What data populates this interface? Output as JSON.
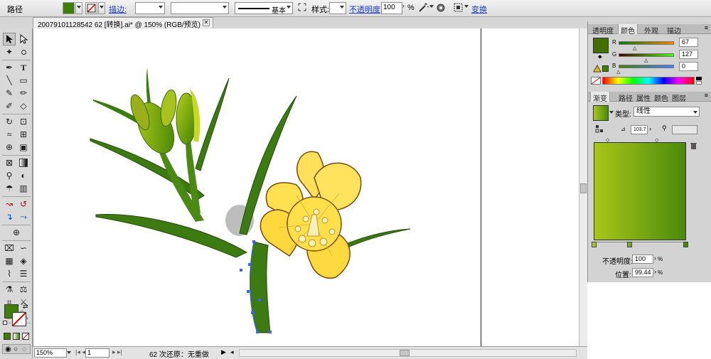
{
  "control_bar": {
    "object_type": "路径",
    "stroke_label": "描边:",
    "stroke_profile": "基本",
    "style_label": "样式:",
    "opacity_label": "不透明度",
    "opacity_value": "100",
    "opacity_unit": "%",
    "transform_label": "变换"
  },
  "document_tab": {
    "title": "20079101128542 62 [转换].ai* @ 150% (RGB/预览)"
  },
  "status_bar": {
    "zoom": "150%",
    "artboard": "1",
    "message": "62 次还原：无重做"
  },
  "color_panel": {
    "tabs": [
      "透明度",
      "颜色",
      "外观",
      "描边"
    ],
    "active_tab": "颜色",
    "fill_color": "#436f00",
    "channels": [
      {
        "name": "R",
        "value": "67",
        "level": 0.26
      },
      {
        "name": "G",
        "value": "127",
        "level": 0.5
      },
      {
        "name": "B",
        "value": "0",
        "level": 0.0
      }
    ]
  },
  "gradient_panel": {
    "tabs": [
      "渐变",
      "路径",
      "属性",
      "颜色",
      "图层"
    ],
    "active_tab": "渐变",
    "type_label": "类型:",
    "type_value": "线性",
    "angle_value": "103.7",
    "start_color": "#a9c61a",
    "end_color": "#4b8a0c",
    "opacity_label": "不透明度:",
    "opacity_value": "100",
    "location_label": "位置:",
    "location_value": "99.44",
    "unit": "%"
  }
}
